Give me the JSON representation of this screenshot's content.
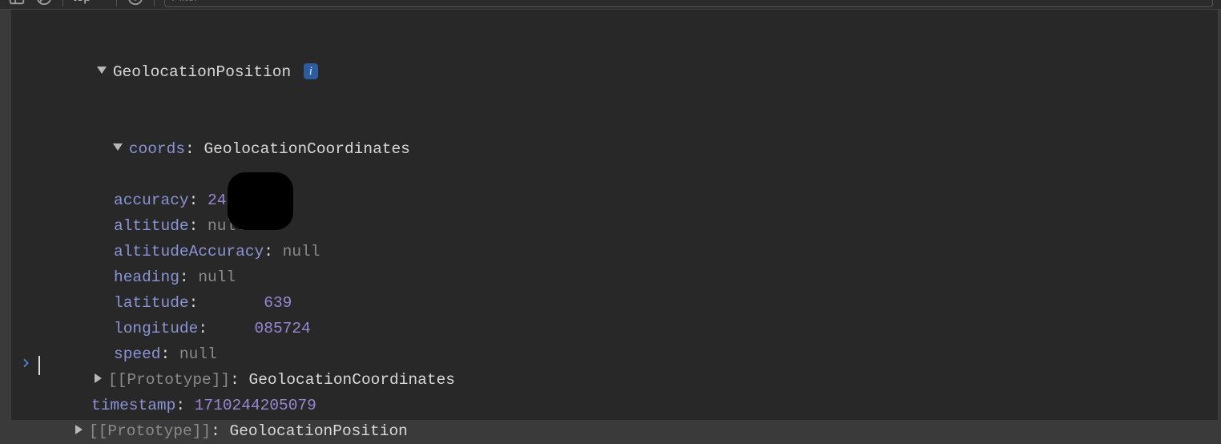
{
  "toolbar": {
    "context_label": "top",
    "filter_placeholder": "Filter"
  },
  "root": {
    "typename": "GeolocationPosition",
    "info_glyph": "i",
    "coords": {
      "key": "coords",
      "typename": "GeolocationCoordinates",
      "accuracy": {
        "key": "accuracy",
        "value": "24.069"
      },
      "altitude": {
        "key": "altitude",
        "value": "null"
      },
      "altitudeAccuracy": {
        "key": "altitudeAccuracy",
        "value": "null"
      },
      "heading": {
        "key": "heading",
        "value": "null"
      },
      "latitude": {
        "key": "latitude",
        "value_visible_fragment": "639"
      },
      "longitude": {
        "key": "longitude",
        "value_visible_fragment": "085724"
      },
      "speed": {
        "key": "speed",
        "value": "null"
      },
      "proto": {
        "key": "[[Prototype]]",
        "value": "GeolocationCoordinates"
      }
    },
    "timestamp": {
      "key": "timestamp",
      "value": "1710244205079"
    },
    "proto": {
      "key": "[[Prototype]]",
      "value": "GeolocationPosition"
    }
  }
}
